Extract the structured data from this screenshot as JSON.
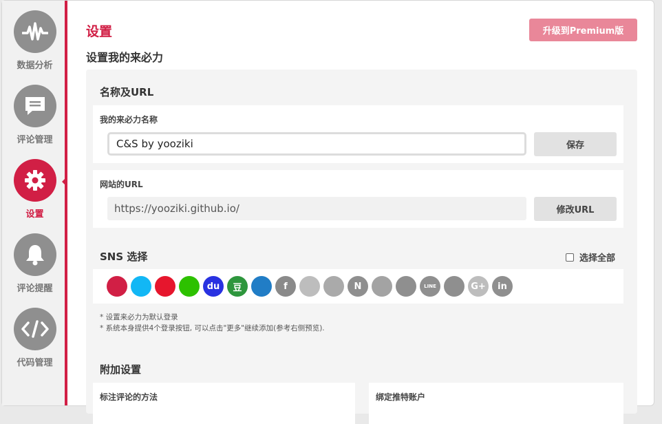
{
  "sidebar": {
    "items": [
      {
        "label": "数据分析",
        "icon": "activity-icon",
        "active": false
      },
      {
        "label": "评论管理",
        "icon": "comment-icon",
        "active": false
      },
      {
        "label": "设置",
        "icon": "gear-icon",
        "active": true
      },
      {
        "label": "评论提醒",
        "icon": "bell-icon",
        "active": false
      },
      {
        "label": "代码管理",
        "icon": "code-icon",
        "active": false
      }
    ]
  },
  "header": {
    "title": "设置",
    "subtitle": "设置我的来必力",
    "premium_button": "升级到Premium版"
  },
  "name_url_section": {
    "title": "名称及URL",
    "name_label": "我的来必力名称",
    "name_value": "C&S by yooziki",
    "save_button": "保存",
    "url_label": "网站的URL",
    "url_value": "https://yooziki.github.io/",
    "modify_button": "修改URL"
  },
  "sns_section": {
    "title": "SNS 选择",
    "select_all": "选择全部",
    "icons": [
      {
        "name": "daum",
        "glyph": "",
        "color": "#d11f45",
        "active": true
      },
      {
        "name": "qq",
        "glyph": "",
        "color": "#12b7f5",
        "active": true
      },
      {
        "name": "weibo",
        "glyph": "",
        "color": "#e6162d",
        "active": true
      },
      {
        "name": "wechat",
        "glyph": "",
        "color": "#2dc100",
        "active": true
      },
      {
        "name": "baidu",
        "glyph": "du",
        "color": "#2932e1",
        "active": true
      },
      {
        "name": "douban",
        "glyph": "豆",
        "color": "#2e963d",
        "active": true
      },
      {
        "name": "renren",
        "glyph": "",
        "color": "#217dc6",
        "active": true
      },
      {
        "name": "facebook",
        "glyph": "f",
        "color": "#8a8a8a",
        "active": false
      },
      {
        "name": "twitter",
        "glyph": "",
        "color": "#bdbdbd",
        "active": false
      },
      {
        "name": "kakao",
        "glyph": "",
        "color": "#aaaaaa",
        "active": false
      },
      {
        "name": "naver",
        "glyph": "N",
        "color": "#8f8f8f",
        "active": false
      },
      {
        "name": "band",
        "glyph": "",
        "color": "#a3a3a3",
        "active": false
      },
      {
        "name": "instagram",
        "glyph": "",
        "color": "#8f8f8f",
        "active": false
      },
      {
        "name": "line",
        "glyph": "LINE",
        "color": "#8f8f8f",
        "active": false
      },
      {
        "name": "github",
        "glyph": "",
        "color": "#8f8f8f",
        "active": false
      },
      {
        "name": "google-plus",
        "glyph": "G+",
        "color": "#bdbdbd",
        "active": false
      },
      {
        "name": "linkedin",
        "glyph": "in",
        "color": "#8f8f8f",
        "active": false
      }
    ],
    "note1": "* 设置来必力为默认登录",
    "note2": "* 系统本身提供4个登录按钮, 可以点击\"更多\"继续添加(参考右侧预览)."
  },
  "additional_section": {
    "title": "附加设置",
    "left_box_title": "标注评论的方法",
    "right_box_title": "绑定推特账户"
  },
  "colors": {
    "accent": "#d11f45",
    "premium": "#e98799",
    "sidebar_icon": "#8f8f8f"
  }
}
